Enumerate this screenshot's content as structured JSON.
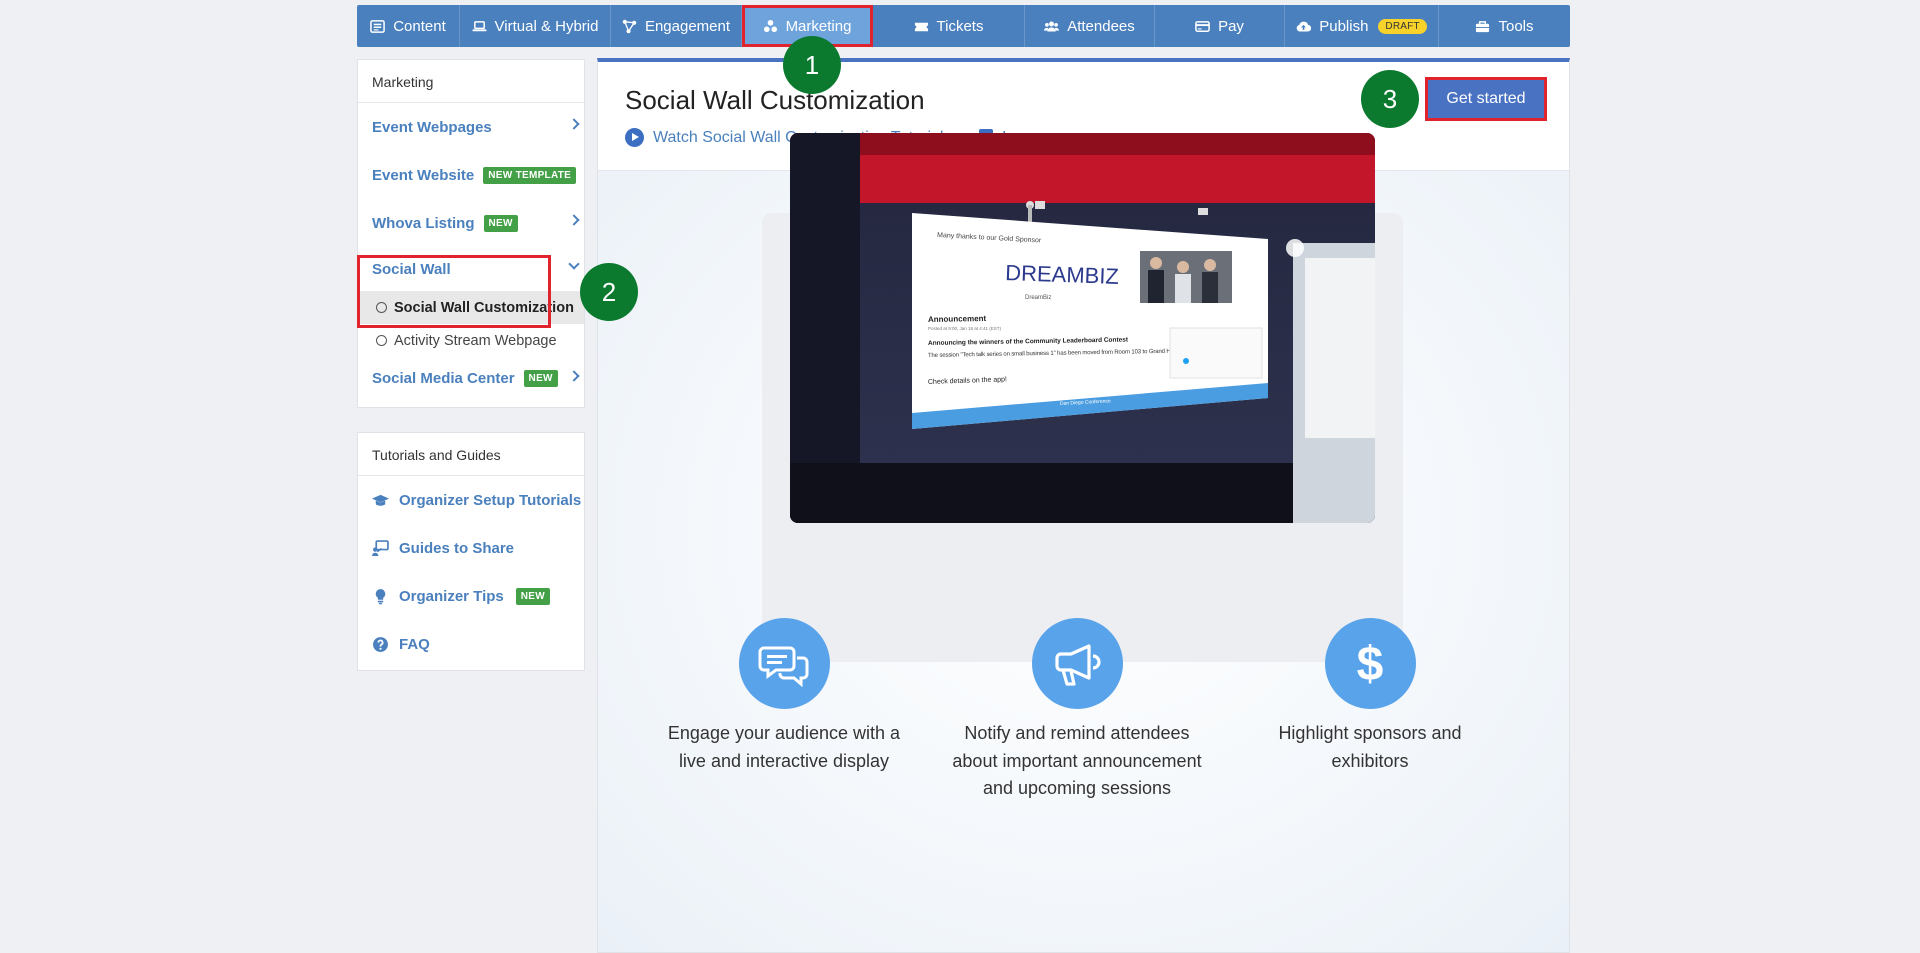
{
  "nav": {
    "items": [
      {
        "label": "Content",
        "icon": "list-icon"
      },
      {
        "label": "Virtual & Hybrid",
        "icon": "laptop-icon"
      },
      {
        "label": "Engagement",
        "icon": "network-icon"
      },
      {
        "label": "Marketing",
        "icon": "marketing-icon",
        "active": true
      },
      {
        "label": "Tickets",
        "icon": "ticket-icon"
      },
      {
        "label": "Attendees",
        "icon": "users-icon"
      },
      {
        "label": "Pay",
        "icon": "card-icon"
      },
      {
        "label": "Publish",
        "icon": "cloud-upload-icon",
        "badge": "DRAFT"
      },
      {
        "label": "Tools",
        "icon": "toolbox-icon"
      }
    ]
  },
  "sidebar": {
    "marketing_title": "Marketing",
    "items": {
      "event_webpages": "Event Webpages",
      "event_website": "Event Website",
      "event_website_badge": "NEW TEMPLATE",
      "whova_listing": "Whova Listing",
      "whova_listing_badge": "NEW",
      "social_wall": "Social Wall",
      "social_wall_customization": "Social Wall Customization",
      "activity_stream": "Activity Stream Webpage",
      "social_media_center": "Social Media Center",
      "social_media_center_badge": "NEW"
    },
    "tutorials_title": "Tutorials and Guides",
    "guides": {
      "setup_tutorials": "Organizer Setup Tutorials",
      "guides_to_share": "Guides to Share",
      "organizer_tips": "Organizer Tips",
      "organizer_tips_badge": "NEW",
      "faq": "FAQ"
    }
  },
  "main": {
    "title": "Social Wall Customization",
    "watch_tutorial": "Watch Social Wall Customization Tutorial",
    "learn_more": "Learn more",
    "get_started": "Get started"
  },
  "photo": {
    "thanks": "Many thanks to our Gold Sponsor",
    "brand": "DREAMBIZ",
    "brand_small": "DreamBiz",
    "announcement": "Announcement",
    "posted": "Posted at 9:00, Jan 18 at 4:41 (EST)",
    "headline": "Announcing the winners of the Community Leaderboard Contest",
    "body": "The session \"Tech talk series on small business 1\" has been moved from Room 103 to Grand Hall.",
    "check": "Check details on the app!",
    "footer": "Dan Diego Conference"
  },
  "features": [
    {
      "icon": "chat-bubbles-icon",
      "text": "Engage your audience with a live and interactive display"
    },
    {
      "icon": "megaphone-icon",
      "text": "Notify and remind attendees about important announcement and upcoming sessions"
    },
    {
      "icon": "dollar-icon",
      "text": "Highlight sponsors and exhibitors"
    }
  ],
  "steps": [
    "1",
    "2",
    "3"
  ],
  "colors": {
    "nav": "#4a80bd",
    "accent": "#4a72c2",
    "highlight": "#e0232c",
    "step": "#0c7a2e",
    "badge_new": "#43a047",
    "badge_draft": "#f7d22a"
  }
}
